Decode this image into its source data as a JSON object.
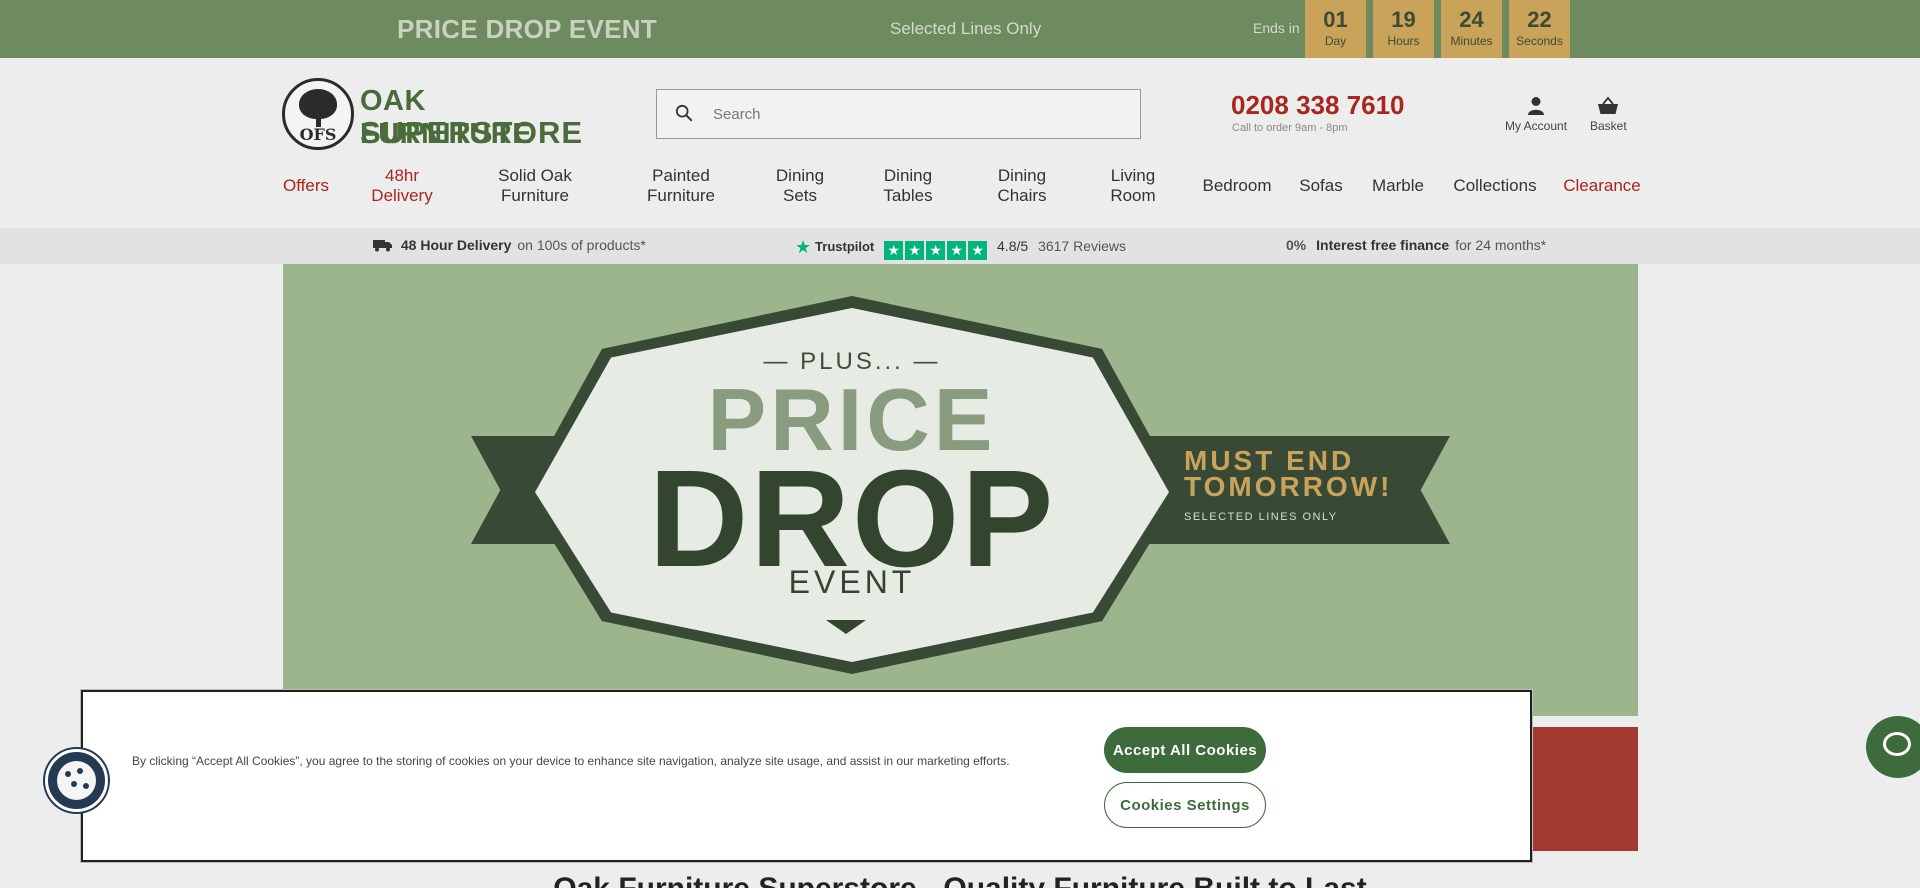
{
  "promo": {
    "title": "PRICE DROP EVENT",
    "subtitle": "Selected Lines Only",
    "ends_label": "Ends in",
    "countdown": [
      {
        "value": "01",
        "unit": "Day"
      },
      {
        "value": "19",
        "unit": "Hours"
      },
      {
        "value": "24",
        "unit": "Minutes"
      },
      {
        "value": "22",
        "unit": "Seconds"
      }
    ]
  },
  "header": {
    "logo_monogram": "OFS",
    "logo_line1": "OAK FURNITURE",
    "logo_line2": "SUPERSTORE",
    "search_placeholder": "Search",
    "phone": "0208 338 7610",
    "phone_sub": "Call to order 9am - 8pm",
    "account_label": "My Account",
    "basket_label": "Basket"
  },
  "nav": {
    "items": [
      {
        "label": "Offers"
      },
      {
        "label": "48hr\nDelivery"
      },
      {
        "label": "Solid Oak\nFurniture"
      },
      {
        "label": "Painted\nFurniture"
      },
      {
        "label": "Dining\nSets"
      },
      {
        "label": "Dining\nTables"
      },
      {
        "label": "Dining\nChairs"
      },
      {
        "label": "Living\nRoom"
      },
      {
        "label": "Bedroom"
      },
      {
        "label": "Sofas"
      },
      {
        "label": "Marble"
      },
      {
        "label": "Collections"
      },
      {
        "label": "Clearance"
      }
    ]
  },
  "usp": {
    "delivery_bold": "48 Hour Delivery",
    "delivery_rest": "on 100s of products*",
    "trustpilot": "Trustpilot",
    "rating": "4.8/5",
    "reviews": "3617 Reviews",
    "finance_pct": "0%",
    "finance_bold": "Interest free finance",
    "finance_rest": "for 24 months*"
  },
  "hero": {
    "plus": "— PLUS... —",
    "price": "PRICE",
    "drop": "DROP",
    "event": "EVENT",
    "must_end_1": "MUST END",
    "must_end_2": "TOMORROW!",
    "must_end_sub": "SELECTED LINES ONLY"
  },
  "page_heading": "Oak Furniture Superstore - Quality Furniture Built to Last",
  "cookie": {
    "text": "By clicking “Accept All Cookies”, you agree to the storing of cookies on your device to enhance site navigation, analyze site usage, and assist in our marketing efforts.",
    "accept_label": "Accept All Cookies",
    "settings_label": "Cookies Settings"
  },
  "colors": {
    "promo_bg": "#6e8a5f",
    "countdown_bg": "#c9a35a",
    "brand_green": "#4a6b3a",
    "brand_red": "#a8261f",
    "button_green": "#3e6b3b",
    "trustpilot_green": "#00b67a"
  },
  "icons": {
    "search": "search-icon",
    "account": "user-icon",
    "basket": "basket-icon",
    "delivery": "van-icon",
    "trustpilot_star": "star-icon",
    "cookie_fab": "cookie-icon",
    "chat": "chat-icon"
  }
}
